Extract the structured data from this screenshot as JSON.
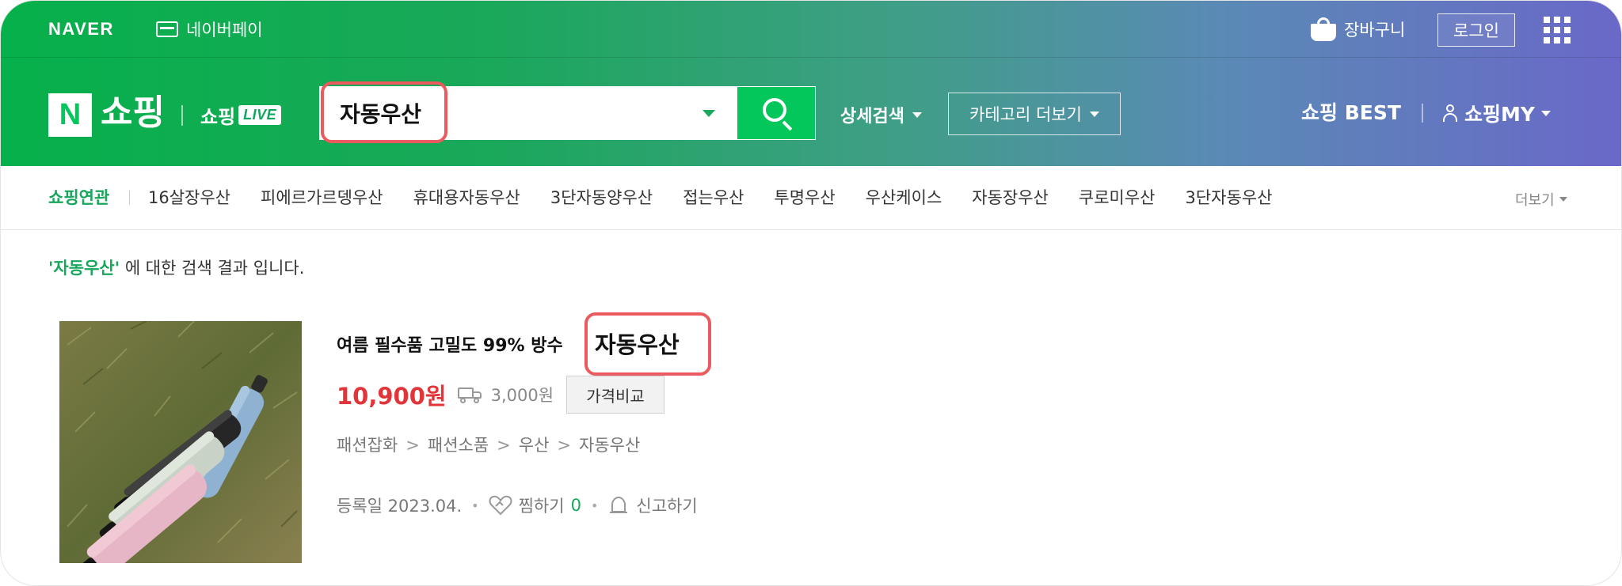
{
  "topbar": {
    "naver_logo": "NAVER",
    "pay_label": "네이버페이",
    "cart_label": "장바구니",
    "login_label": "로그인"
  },
  "header": {
    "n_logo": "N",
    "shopping_title": "쇼핑",
    "shopping_live_prefix": "쇼핑",
    "shopping_live_badge": "LIVE",
    "search_value": "자동우산",
    "detail_search_label": "상세검색",
    "category_more_label": "카테고리 더보기",
    "best_label": "쇼핑 BEST",
    "my_label": "쇼핑MY"
  },
  "related": {
    "label": "쇼핑연관",
    "items": [
      "16살장우산",
      "피에르가르뎅우산",
      "휴대용자동우산",
      "3단자동양우산",
      "접는우산",
      "투명우산",
      "우산케이스",
      "자동장우산",
      "쿠로미우산",
      "3단자동우산"
    ],
    "more_label": "더보기"
  },
  "results": {
    "keyword": "'자동우산'",
    "suffix": " 에 대한 검색 결과 입니다.",
    "product": {
      "title_prefix": "여름 필수품 고밀도 99% 방수",
      "title_keyword": "자동우산",
      "price": "10,900원",
      "shipping": "3,000원",
      "compare_label": "가격비교",
      "breadcrumb": [
        "패션잡화",
        "패션소품",
        "우산",
        "자동우산"
      ],
      "registered": "등록일 2023.04.",
      "zzim_label": "찜하기",
      "zzim_count": "0",
      "report_label": "신고하기"
    }
  },
  "colors": {
    "naver_green": "#03c75a",
    "price_red": "#e1353a",
    "highlight_red": "#ea5a5e"
  }
}
